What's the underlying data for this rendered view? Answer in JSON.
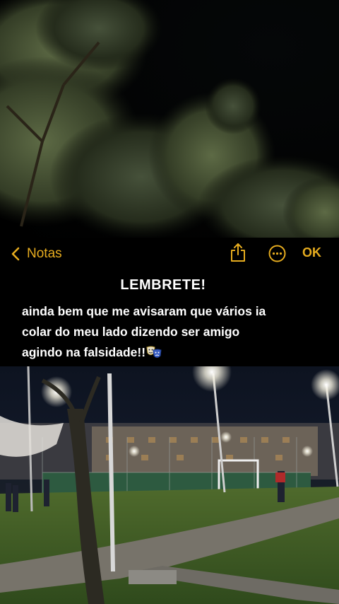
{
  "nav": {
    "back_label": "Notas",
    "ok_label": "OK",
    "accent_color": "#e6ac1f"
  },
  "note": {
    "title": "LEMBRETE!",
    "lines": [
      "ainda bem que me avisaram que vários ia",
      "colar do meu lado dizendo ser amigo",
      "agindo na falsidade!!"
    ],
    "emoji": "performing-arts-masks"
  },
  "icons": {
    "back": "chevron-left-icon",
    "share": "share-icon",
    "more": "ellipsis-circle-icon"
  }
}
